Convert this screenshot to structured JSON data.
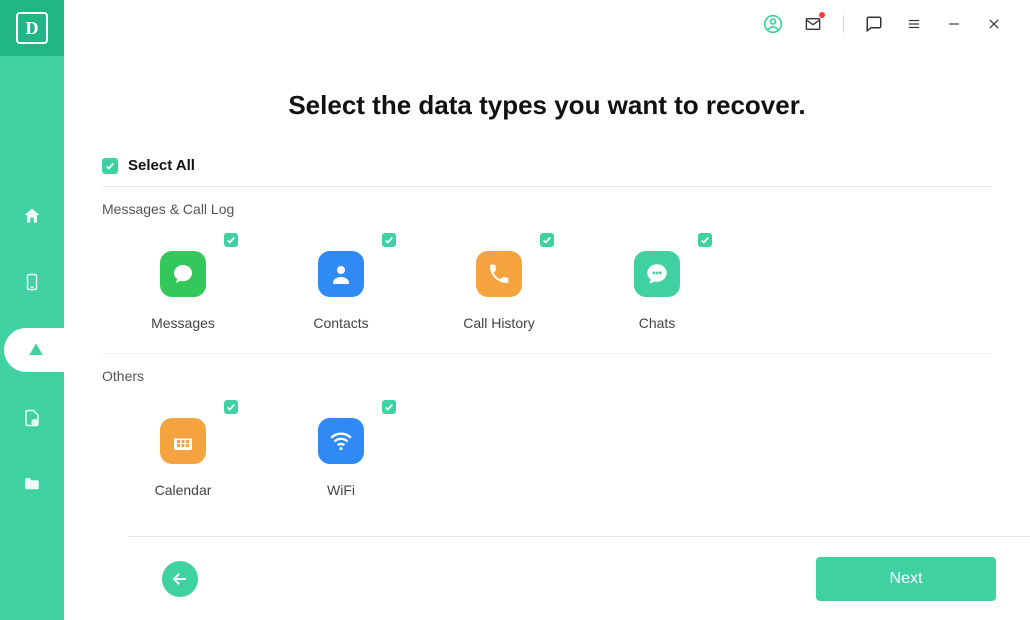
{
  "app_logo_letter": "D",
  "titlebar": {
    "icons": [
      "account",
      "mail",
      "feedback",
      "menu",
      "minimize",
      "close"
    ]
  },
  "page_title": "Select the data types you want to recover.",
  "select_all_label": "Select All",
  "sections": [
    {
      "title": "Messages & Call Log",
      "items": [
        {
          "label": "Messages",
          "icon": "speech-bubble",
          "color": "green",
          "checked": true
        },
        {
          "label": "Contacts",
          "icon": "person",
          "color": "blue",
          "checked": true
        },
        {
          "label": "Call History",
          "icon": "phone",
          "color": "orange",
          "checked": true
        },
        {
          "label": "Chats",
          "icon": "chat-dots",
          "color": "teal",
          "checked": true
        }
      ]
    },
    {
      "title": "Others",
      "items": [
        {
          "label": "Calendar",
          "icon": "calendar",
          "color": "orange",
          "checked": true
        },
        {
          "label": "WiFi",
          "icon": "wifi",
          "color": "blue",
          "checked": true
        }
      ]
    }
  ],
  "footer": {
    "next_label": "Next"
  },
  "colors": {
    "accent": "#3fd1a1"
  }
}
